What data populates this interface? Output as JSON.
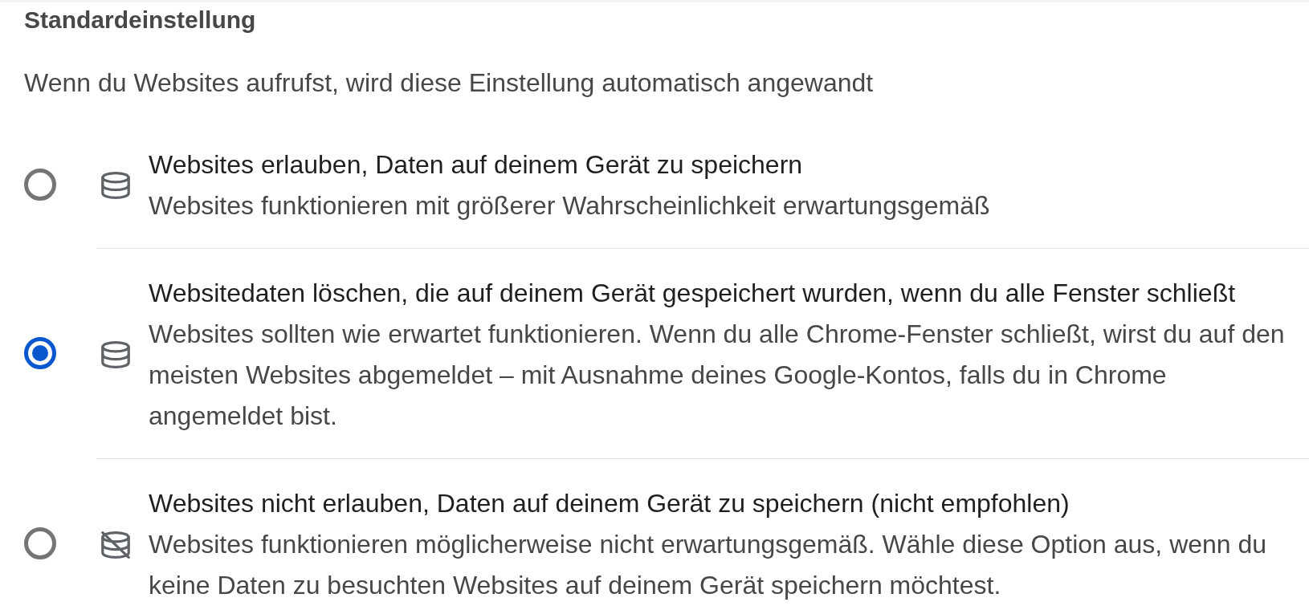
{
  "default_setting": {
    "title": "Standardeinstellung",
    "description": "Wenn du Websites aufrufst, wird diese Einstellung automatisch angewandt",
    "options": [
      {
        "kind": "allow",
        "label": "Websites erlauben, Daten auf deinem Gerät zu speichern",
        "sublabel": "Websites funktionieren mit größerer Wahrscheinlichkeit erwartungsgemäß",
        "selected": false
      },
      {
        "kind": "clear",
        "label": "Websitedaten löschen, die auf deinem Gerät gespeichert wurden, wenn du alle Fenster schließt",
        "sublabel": "Websites sollten wie erwartet funktionieren. Wenn du alle Chrome-Fenster schließt, wirst du auf den meisten Websites abgemeldet – mit Ausnahme deines Google-Kontos, falls du in Chrome angemeldet bist.",
        "selected": true
      },
      {
        "kind": "block",
        "label": "Websites nicht erlauben, Daten auf deinem Gerät zu speichern (nicht empfohlen)",
        "sublabel": "Websites funktionieren möglicherweise nicht erwartungsgemäß. Wähle diese Option aus, wenn du keine Daten zu besuchten Websites auf deinem Gerät speichern möchtest.",
        "selected": false
      }
    ]
  }
}
